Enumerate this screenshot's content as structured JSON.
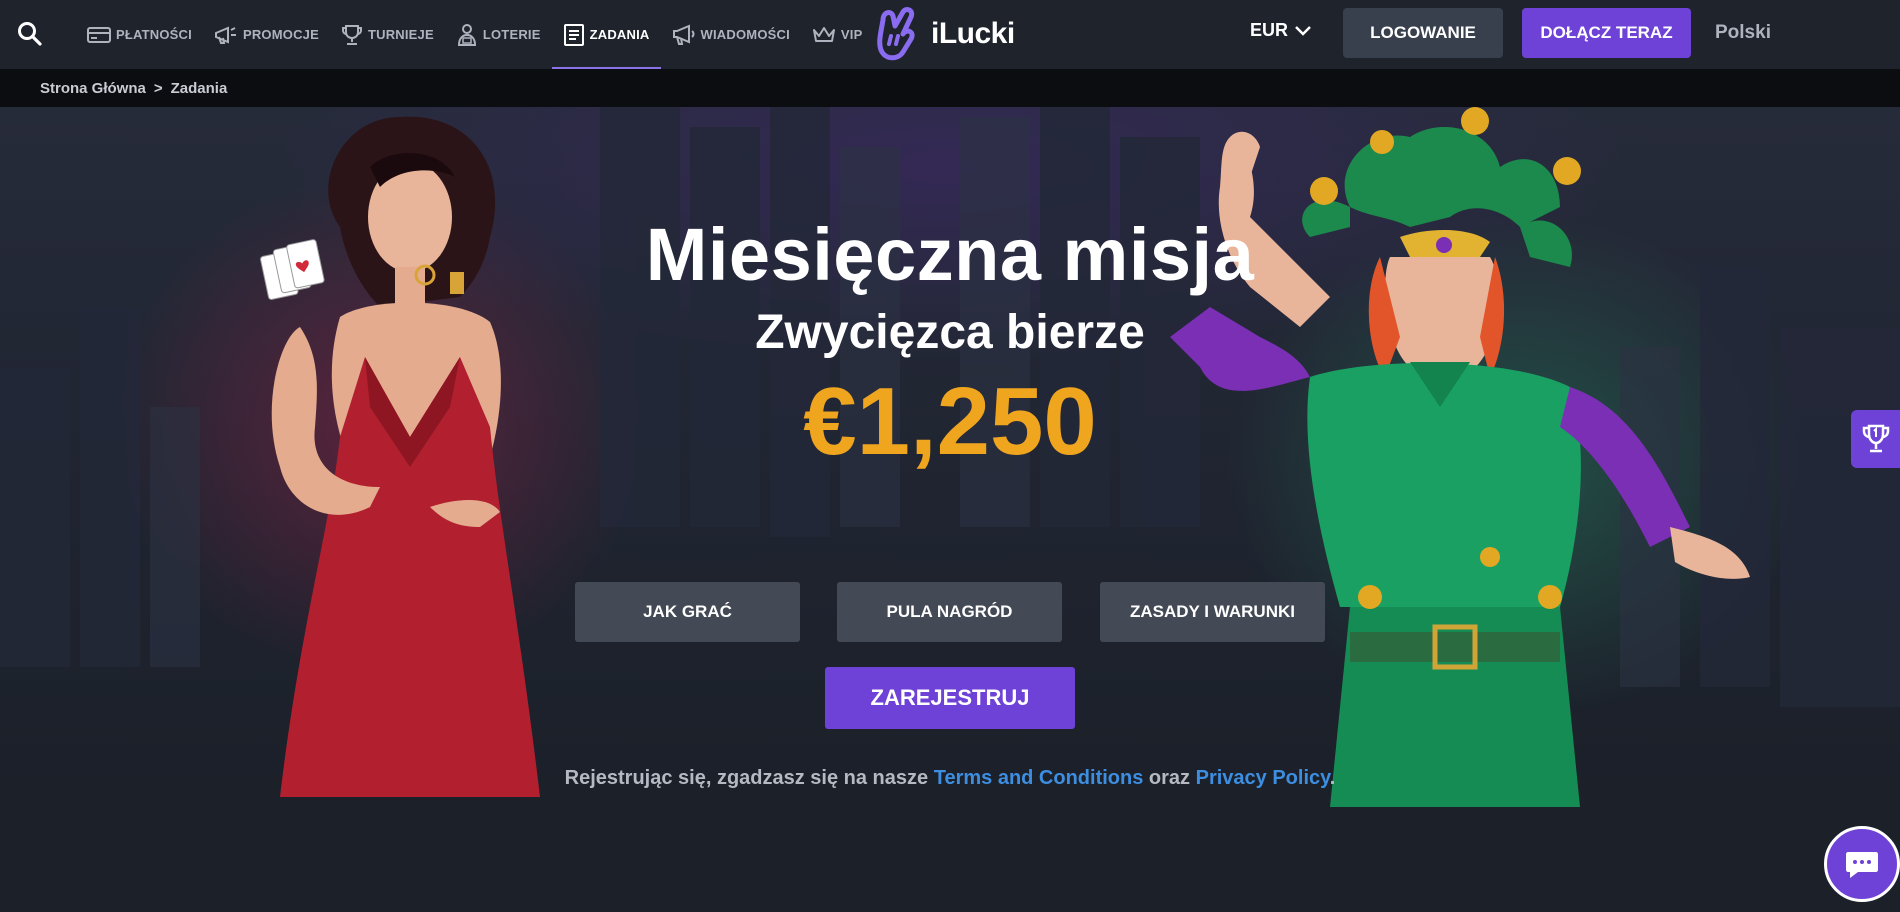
{
  "header": {
    "nav": [
      {
        "label": "PŁATNOŚCI",
        "icon": "card-icon"
      },
      {
        "label": "PROMOCJE",
        "icon": "megaphone-icon"
      },
      {
        "label": "TURNIEJE",
        "icon": "trophy-icon"
      },
      {
        "label": "LOTERIE",
        "icon": "ticket-person-icon"
      },
      {
        "label": "ZADANIA",
        "icon": "task-list-icon",
        "active": true
      },
      {
        "label": "WIADOMOŚCI",
        "icon": "announcement-icon"
      },
      {
        "label": "VIP",
        "icon": "crown-icon"
      }
    ],
    "logo_text": "iLucki",
    "currency": "EUR",
    "login_label": "LOGOWANIE",
    "join_label": "DOŁĄCZ TERAZ",
    "language": "Polski"
  },
  "breadcrumb": {
    "home": "Strona Główna",
    "separator": ">",
    "current": "Zadania"
  },
  "hero": {
    "title": "Miesięczna misja",
    "subtitle": "Zwycięzca bierze",
    "amount": "€1,250",
    "buttons": {
      "how_to_play": "JAK GRAĆ",
      "prize_pool": "PULA NAGRÓD",
      "terms": "ZASADY I WARUNKI"
    },
    "register_label": "ZAREJESTRUJ",
    "terms_prefix": "Rejestrując się, zgadzasz się na nasze",
    "terms_link": "Terms and Conditions",
    "terms_and": "oraz",
    "privacy_link": "Privacy Policy",
    "terms_suffix": "."
  },
  "colors": {
    "accent": "#6e42d6",
    "amount": "#f0a51f",
    "link": "#3d8ee0",
    "header_bg": "#1e232c"
  }
}
